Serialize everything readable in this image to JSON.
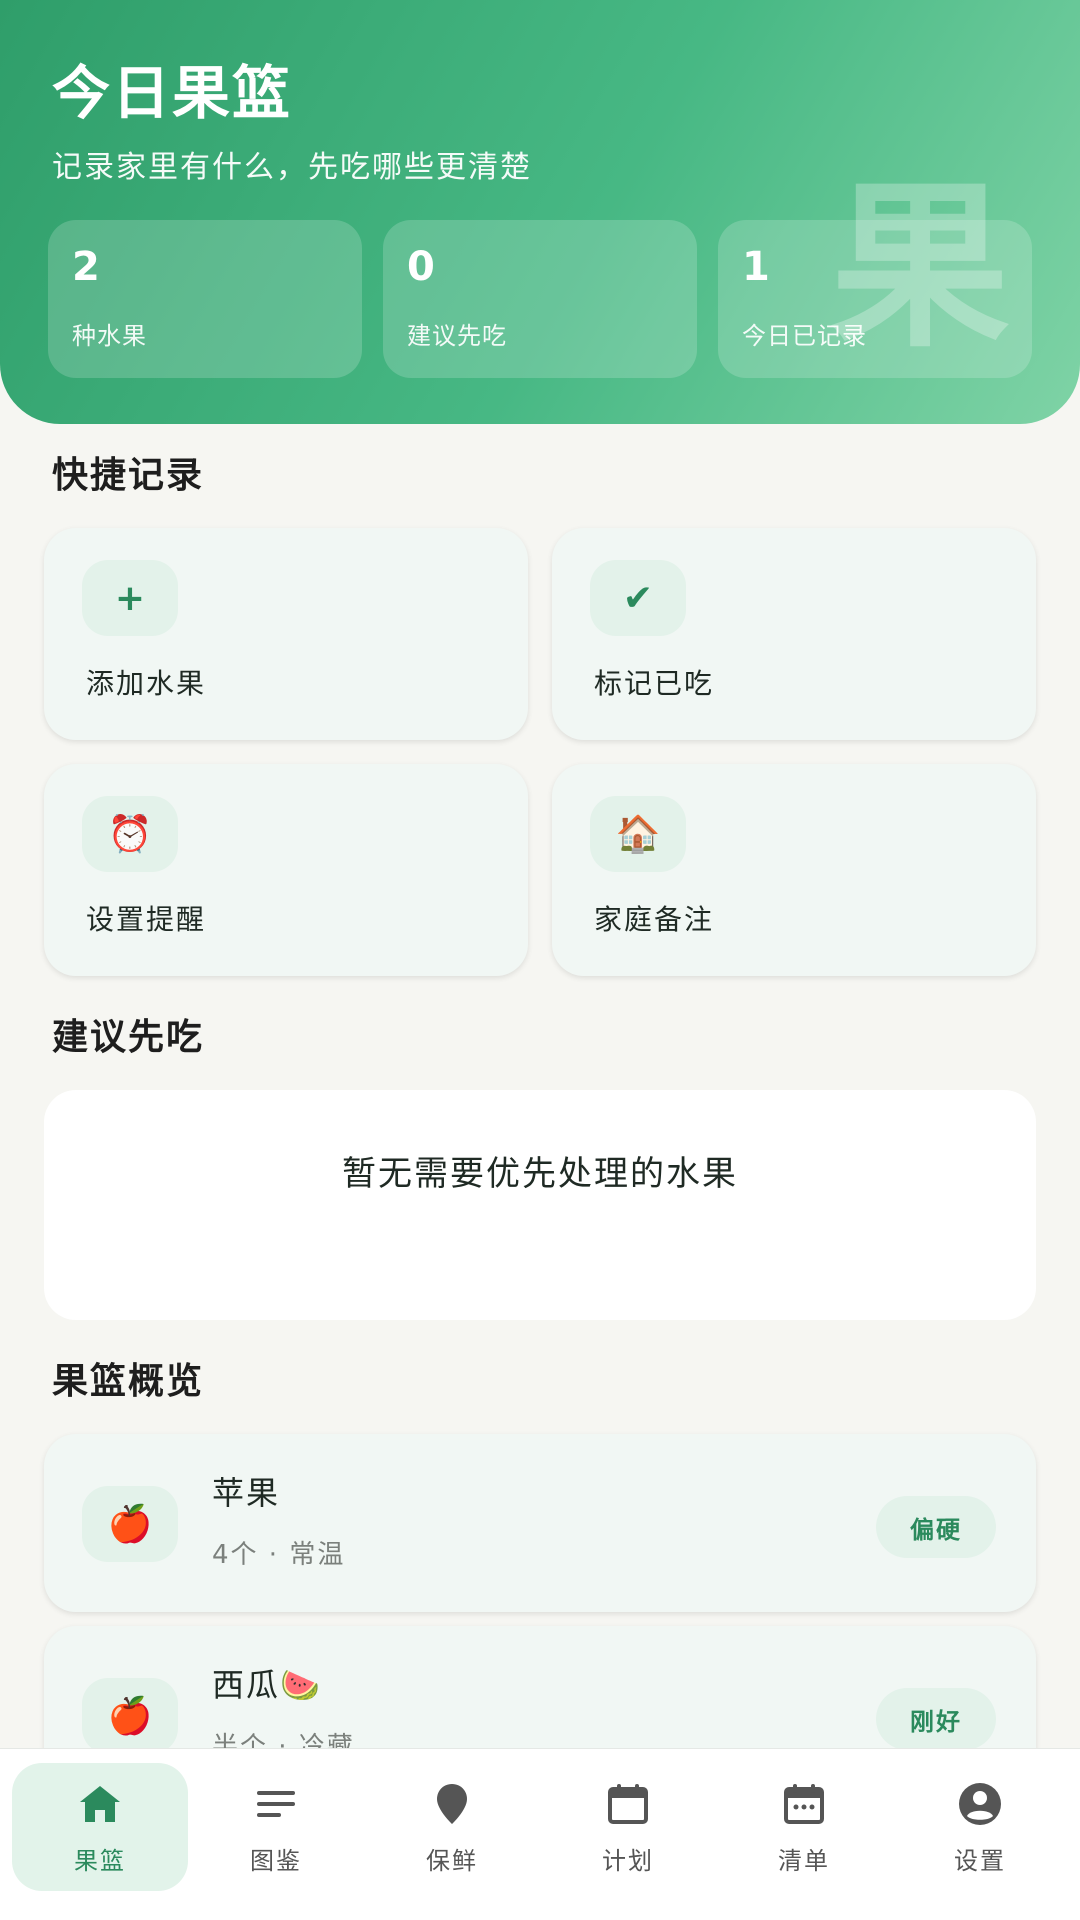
{
  "header": {
    "title": "今日果篮",
    "subtitle": "记录家里有什么，先吃哪些更清楚",
    "watermark": "果",
    "stats": [
      {
        "value": "2",
        "label": "种水果"
      },
      {
        "value": "0",
        "label": "建议先吃"
      },
      {
        "value": "1",
        "label": "今日已记录"
      }
    ]
  },
  "quick": {
    "title": "快捷记录",
    "items": [
      {
        "label": "添加水果",
        "icon": "plus-icon",
        "glyph": "+"
      },
      {
        "label": "标记已吃",
        "icon": "check-icon",
        "glyph": "✔"
      },
      {
        "label": "设置提醒",
        "icon": "alarm-clock-icon",
        "glyph": "⏰"
      },
      {
        "label": "家庭备注",
        "icon": "house-icon",
        "glyph": "🏠"
      }
    ]
  },
  "suggest": {
    "title": "建议先吃",
    "empty_text": "暂无需要优先处理的水果"
  },
  "overview": {
    "title": "果篮概览",
    "items": [
      {
        "name": "苹果",
        "meta": "4个 · 常温",
        "badge": "偏硬",
        "icon": "apple-icon",
        "glyph": "🍎"
      },
      {
        "name": "西瓜🍉",
        "meta": "半个 · 冷藏",
        "badge": "刚好",
        "icon": "apple-icon",
        "glyph": "🍎"
      }
    ]
  },
  "nav": {
    "items": [
      {
        "label": "果篮",
        "icon": "home-icon",
        "active": true
      },
      {
        "label": "图鉴",
        "icon": "list-icon",
        "active": false
      },
      {
        "label": "保鲜",
        "icon": "location-pin-icon",
        "active": false
      },
      {
        "label": "计划",
        "icon": "calendar-icon",
        "active": false
      },
      {
        "label": "清单",
        "icon": "calendar-dots-icon",
        "active": false
      },
      {
        "label": "设置",
        "icon": "account-circle-icon",
        "active": false
      }
    ]
  },
  "colors": {
    "accent": "#2b8a5d",
    "header_start": "#2f9e6a",
    "header_end": "#7fd3a6",
    "card_bg": "#f1f7f4",
    "icon_bg": "#e3f2ea"
  }
}
